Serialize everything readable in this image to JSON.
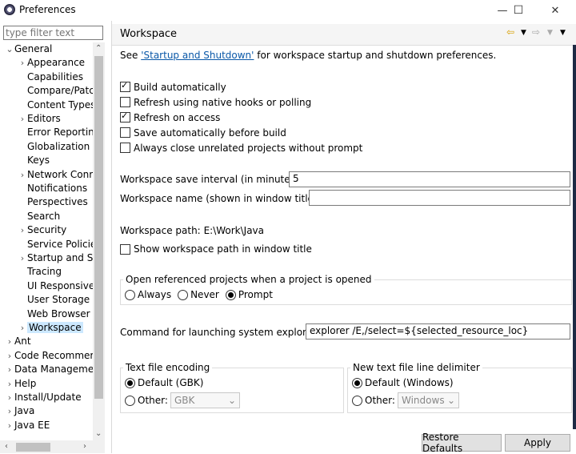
{
  "window": {
    "title": "Preferences",
    "minimize": "—",
    "maximize": "☐",
    "close": "✕"
  },
  "filter": {
    "placeholder": "type filter text"
  },
  "tree": {
    "items": [
      {
        "label": "General",
        "twist": "⌄"
      },
      {
        "label": "Appearance",
        "twist": "›"
      },
      {
        "label": "Capabilities",
        "twist": ""
      },
      {
        "label": "Compare/Patc",
        "twist": ""
      },
      {
        "label": "Content Types",
        "twist": ""
      },
      {
        "label": "Editors",
        "twist": "›"
      },
      {
        "label": "Error Reportin",
        "twist": ""
      },
      {
        "label": "Globalization",
        "twist": ""
      },
      {
        "label": "Keys",
        "twist": ""
      },
      {
        "label": "Network Conr",
        "twist": "›"
      },
      {
        "label": "Notifications",
        "twist": ""
      },
      {
        "label": "Perspectives",
        "twist": ""
      },
      {
        "label": "Search",
        "twist": ""
      },
      {
        "label": "Security",
        "twist": "›"
      },
      {
        "label": "Service Policie",
        "twist": ""
      },
      {
        "label": "Startup and Sh",
        "twist": "›"
      },
      {
        "label": "Tracing",
        "twist": ""
      },
      {
        "label": "UI Responsive",
        "twist": ""
      },
      {
        "label": "User Storage S",
        "twist": ""
      },
      {
        "label": "Web Browser",
        "twist": ""
      },
      {
        "label": "Workspace",
        "twist": "›"
      },
      {
        "label": "Ant",
        "twist": "›"
      },
      {
        "label": "Code Recommer",
        "twist": "›"
      },
      {
        "label": "Data Managemer",
        "twist": "›"
      },
      {
        "label": "Help",
        "twist": "›"
      },
      {
        "label": "Install/Update",
        "twist": "›"
      },
      {
        "label": "Java",
        "twist": "›"
      },
      {
        "label": "Java EE",
        "twist": "›"
      }
    ]
  },
  "page": {
    "title": "Workspace",
    "intro_prefix": "See ",
    "intro_link": "'Startup and Shutdown'",
    "intro_suffix": " for workspace startup and shutdown preferences.",
    "checks": [
      {
        "label": "Build automatically",
        "checked": true
      },
      {
        "label": "Refresh using native hooks or polling",
        "checked": false
      },
      {
        "label": "Refresh on access",
        "checked": true
      },
      {
        "label": "Save automatically before build",
        "checked": false
      },
      {
        "label": "Always close unrelated projects without prompt",
        "checked": false
      }
    ],
    "save_interval_label": "Workspace save interval (in minutes):",
    "save_interval_value": "5",
    "name_label": "Workspace name (shown in window title):",
    "name_value": "",
    "path_label": "Workspace path:",
    "path_value": "E:\\Work\\Java",
    "show_path_label": "Show workspace path in window title",
    "open_ref_title": "Open referenced projects when a project is opened",
    "open_ref_options": [
      "Always",
      "Never",
      "Prompt"
    ],
    "open_ref_selected": "Prompt",
    "explorer_label": "Command for launching system explorer:",
    "explorer_value": "explorer /E,/select=${selected_resource_loc}",
    "encoding": {
      "title": "Text file encoding",
      "default_label": "Default (GBK)",
      "other_label": "Other:",
      "other_value": "GBK"
    },
    "delimiter": {
      "title": "New text file line delimiter",
      "default_label": "Default (Windows)",
      "other_label": "Other:",
      "other_value": "Windows"
    },
    "restore_defaults": "Restore Defaults",
    "apply": "Apply"
  }
}
